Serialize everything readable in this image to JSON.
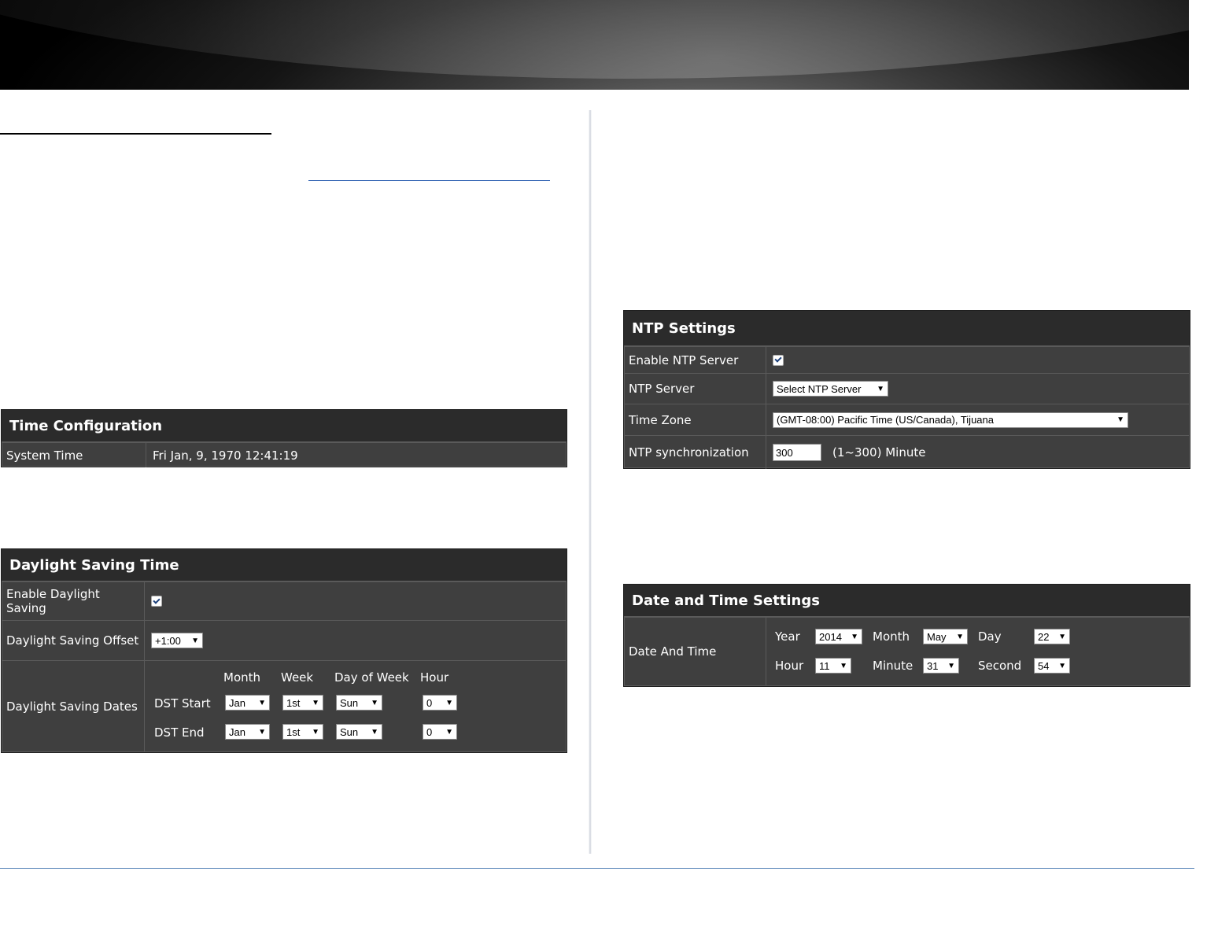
{
  "time_config": {
    "title": "Time Configuration",
    "system_time_label": "System Time",
    "system_time_value": "Fri Jan, 9, 1970 12:41:19"
  },
  "dst": {
    "title": "Daylight Saving Time",
    "enable_label": "Enable Daylight Saving",
    "offset_label": "Daylight Saving Offset",
    "offset_value": "+1:00",
    "dates_label": "Daylight Saving Dates",
    "col_month": "Month",
    "col_week": "Week",
    "col_dow": "Day of Week",
    "col_hour": "Hour",
    "start_label": "DST Start",
    "end_label": "DST End",
    "start": {
      "month": "Jan",
      "week": "1st",
      "dow": "Sun",
      "hour": "0"
    },
    "end": {
      "month": "Jan",
      "week": "1st",
      "dow": "Sun",
      "hour": "0"
    }
  },
  "ntp": {
    "title": "NTP Settings",
    "enable_label": "Enable NTP Server",
    "server_label": "NTP Server",
    "server_value": "Select NTP Server",
    "tz_label": "Time Zone",
    "tz_value": "(GMT-08:00) Pacific Time (US/Canada), Tijuana",
    "sync_label": "NTP synchronization",
    "sync_value": "300",
    "sync_unit": "(1~300) Minute"
  },
  "datetime": {
    "title": "Date and Time Settings",
    "label": "Date And Time",
    "year_label": "Year",
    "year": "2014",
    "month_label": "Month",
    "month": "May",
    "day_label": "Day",
    "day": "22",
    "hour_label": "Hour",
    "hour": "11",
    "minute_label": "Minute",
    "minute": "31",
    "second_label": "Second",
    "second": "54"
  }
}
